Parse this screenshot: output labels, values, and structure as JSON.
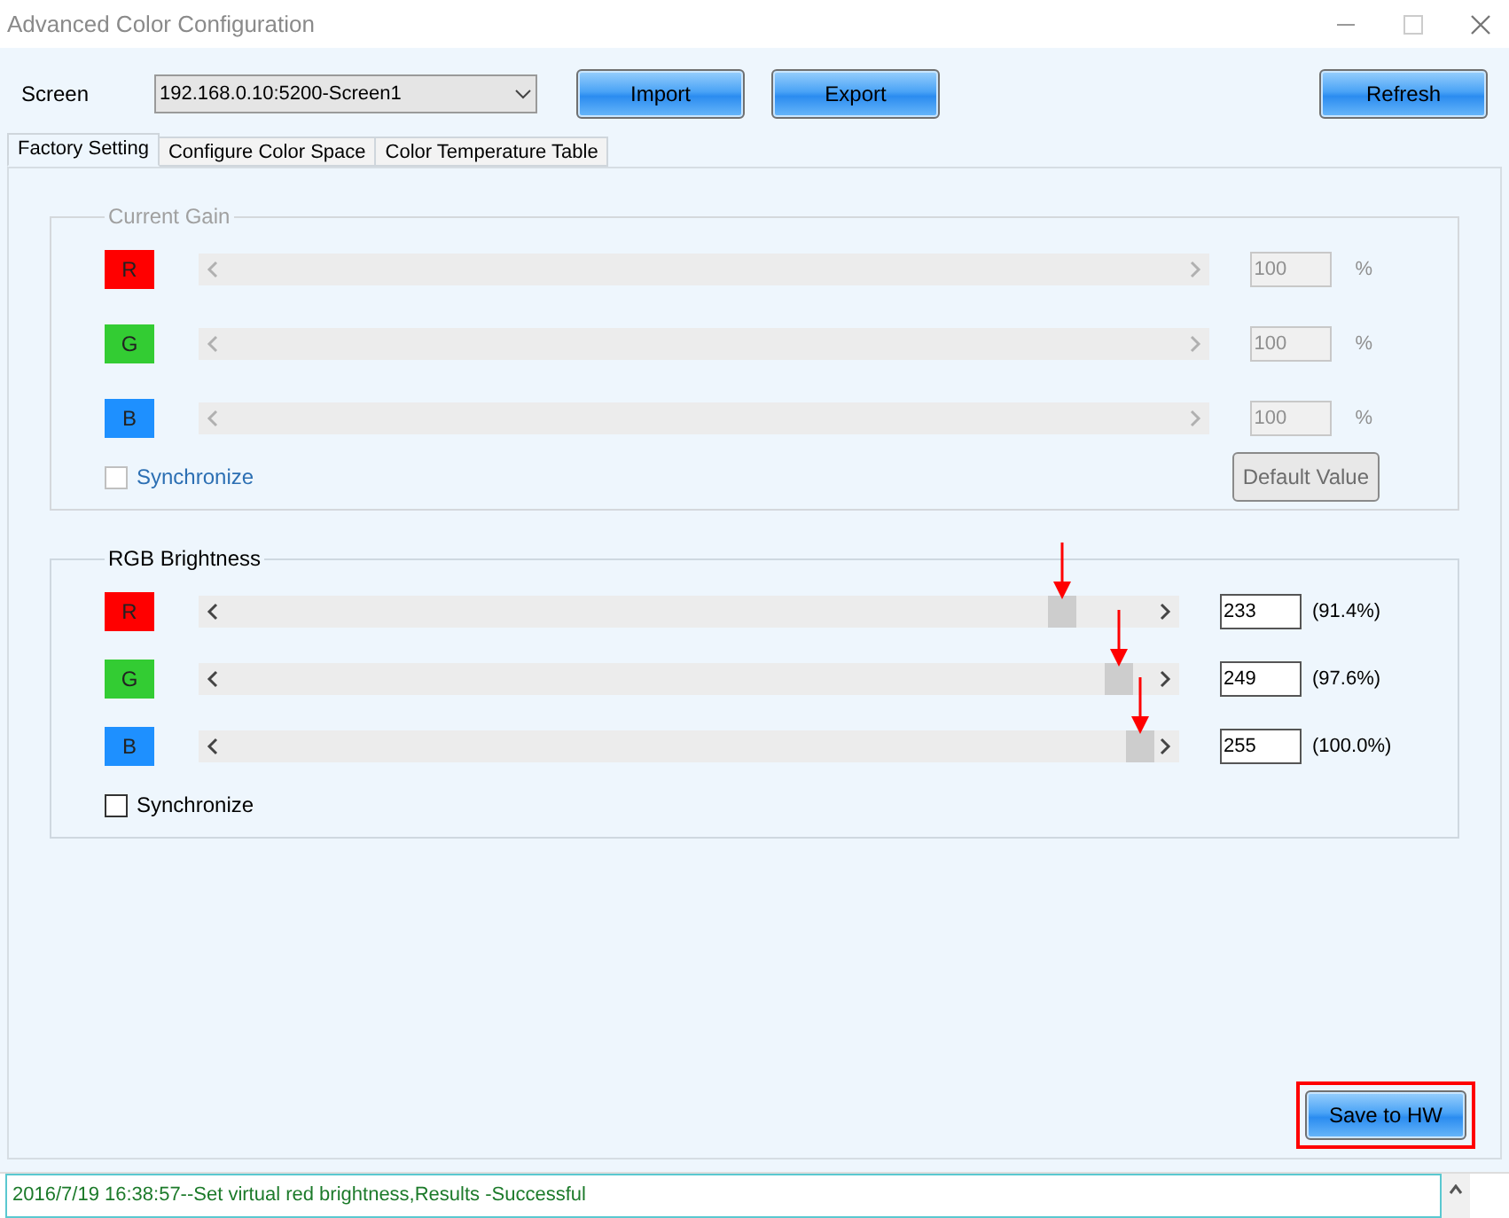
{
  "window": {
    "title": "Advanced Color Configuration"
  },
  "screen": {
    "label": "Screen",
    "value": "192.168.0.10:5200-Screen1"
  },
  "buttons": [
    {
      "label": "Import"
    },
    {
      "label": "Export"
    }
  ],
  "refresh_button": "Refresh",
  "tabs": [
    {
      "label": "Factory Setting",
      "selected": true
    },
    {
      "label": "Configure Color Space",
      "selected": false
    },
    {
      "label": "Color Temperature Table",
      "selected": false
    }
  ],
  "groups": [
    {
      "title": "Current Gain",
      "disabled": true,
      "channels": [
        {
          "name": "R",
          "color": "#ff0000",
          "value": "100",
          "unit": "%"
        },
        {
          "name": "G",
          "color": "#33cc33",
          "value": "100",
          "unit": "%"
        },
        {
          "name": "B",
          "color": "#1e90ff",
          "value": "100",
          "unit": "%"
        }
      ],
      "synchronize": {
        "label": "Synchronize",
        "checked": false
      },
      "default_button": "Default Value"
    },
    {
      "title": "RGB Brightness",
      "disabled": false,
      "channels": [
        {
          "name": "R",
          "color": "#ff0000",
          "level": 0.914,
          "value": "233",
          "reading": "(91.4%)"
        },
        {
          "name": "G",
          "color": "#33cc33",
          "level": 0.976,
          "value": "249",
          "reading": "(97.6%)"
        },
        {
          "name": "B",
          "color": "#1e90ff",
          "level": 1.0,
          "value": "255",
          "reading": "(100.0%)"
        }
      ],
      "synchronize": {
        "label": "Synchronize",
        "checked": false
      }
    }
  ],
  "save_button": "Save to HW",
  "log": {
    "text": "2016/7/19 16:38:57--Set virtual red brightness,Results -Successful"
  }
}
